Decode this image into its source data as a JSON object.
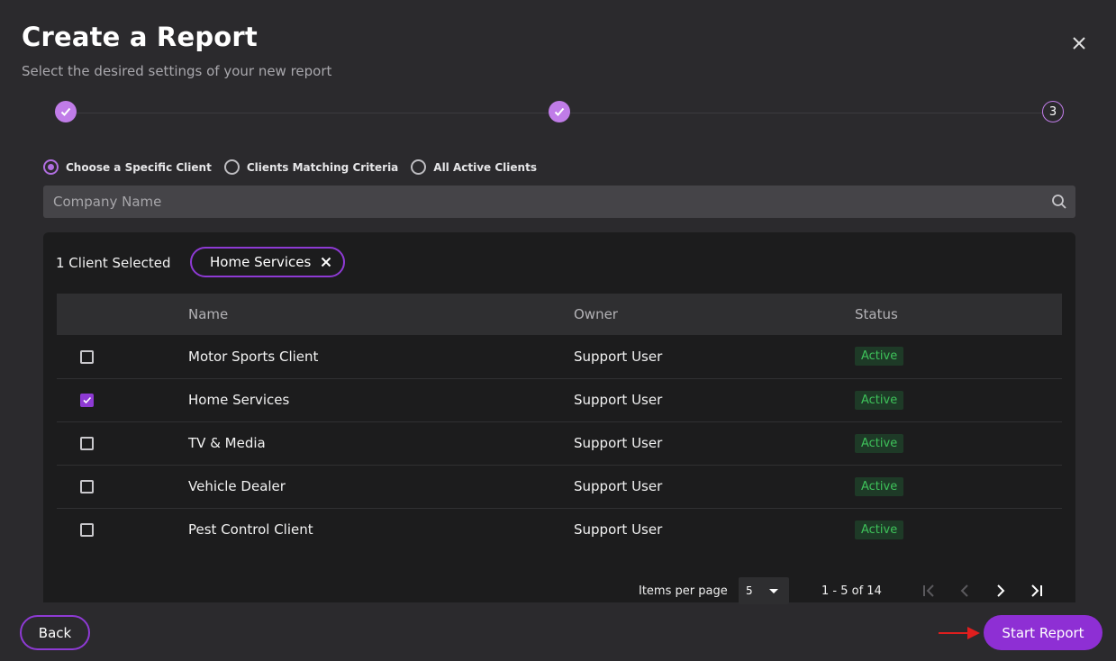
{
  "header": {
    "title": "Create a Report",
    "subtitle": "Select the desired settings of your new report"
  },
  "stepper": {
    "current_step": "3"
  },
  "client_scope": {
    "options": [
      {
        "label": "Choose a Specific Client",
        "selected": true
      },
      {
        "label": "Clients Matching Criteria",
        "selected": false
      },
      {
        "label": "All Active Clients",
        "selected": false
      }
    ]
  },
  "search": {
    "placeholder": "Company Name"
  },
  "selection": {
    "count_label": "1 Client Selected",
    "chips": [
      "Home Services"
    ]
  },
  "table": {
    "columns": [
      "Name",
      "Owner",
      "Status"
    ],
    "rows": [
      {
        "name": "Motor Sports Client",
        "owner": "Support User",
        "status": "Active",
        "checked": false
      },
      {
        "name": "Home Services",
        "owner": "Support User",
        "status": "Active",
        "checked": true
      },
      {
        "name": "TV & Media",
        "owner": "Support User",
        "status": "Active",
        "checked": false
      },
      {
        "name": "Vehicle Dealer",
        "owner": "Support User",
        "status": "Active",
        "checked": false
      },
      {
        "name": "Pest Control Client",
        "owner": "Support User",
        "status": "Active",
        "checked": false
      }
    ]
  },
  "paginator": {
    "items_per_page_label": "Items per page",
    "items_per_page_value": "5",
    "range_label": "1 - 5 of 14"
  },
  "footer": {
    "back_label": "Back",
    "start_label": "Start Report"
  },
  "colors": {
    "accent": "#8e2fd4",
    "step_done": "#c07ce8",
    "status_active_text": "#3ec25a",
    "status_active_bg": "#1e3a27",
    "annotation_arrow": "#e01e1e"
  }
}
